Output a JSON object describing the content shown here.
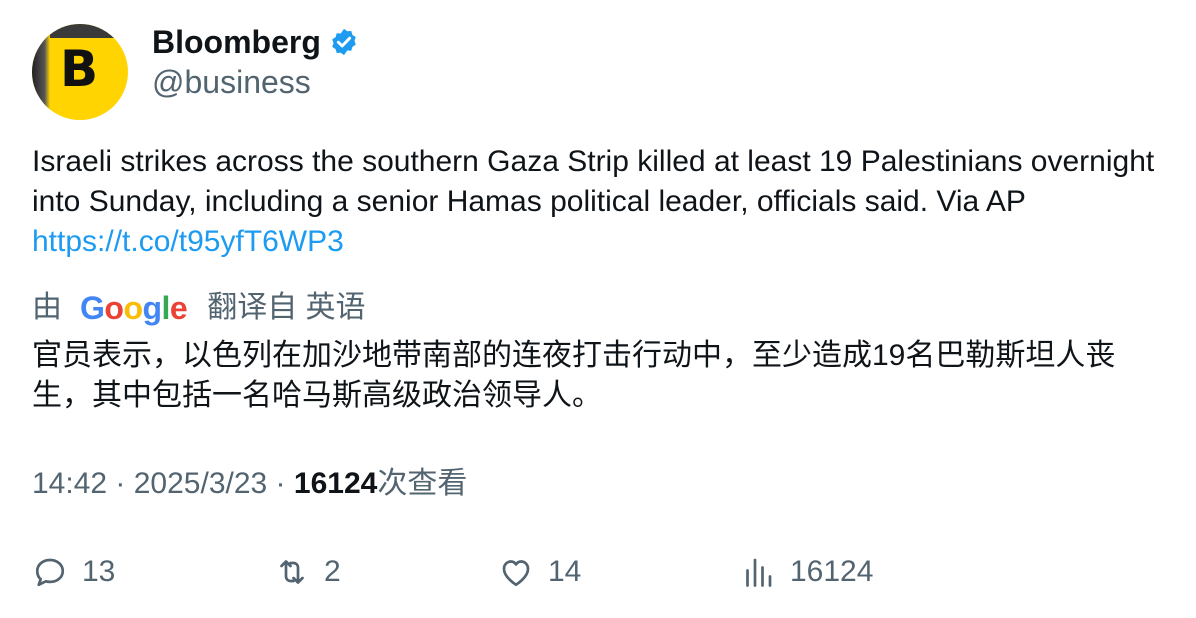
{
  "account": {
    "display_name": "Bloomberg",
    "handle": "@business",
    "avatar_letter": "B",
    "avatar_color": "#ffd400",
    "verified_color": "#1d9bf0"
  },
  "tweet": {
    "text": "Israeli strikes across the southern Gaza Strip killed at least 19 Palestinians overnight into Sunday, including a senior Hamas political leader, officials said. Via AP ",
    "link": "https://t.co/t95yfT6WP3",
    "link_color": "#1d9bf0"
  },
  "translation": {
    "prefix": "由",
    "provider_letters": [
      "G",
      "o",
      "o",
      "g",
      "l",
      "e"
    ],
    "suffix": "翻译自 英语",
    "text": "官员表示，以色列在加沙地带南部的连夜打击行动中，至少造成19名巴勒斯坦人丧生，其中包括一名哈马斯高级政治领导人。"
  },
  "meta": {
    "time": "14:42",
    "separator": " · ",
    "date": "2025/3/23",
    "views_count": "16124",
    "views_label": "次查看"
  },
  "actions": {
    "replies": "13",
    "reposts": "2",
    "likes": "14",
    "views": "16124",
    "icons": [
      "reply-icon",
      "repost-icon",
      "like-icon",
      "views-icon"
    ]
  }
}
